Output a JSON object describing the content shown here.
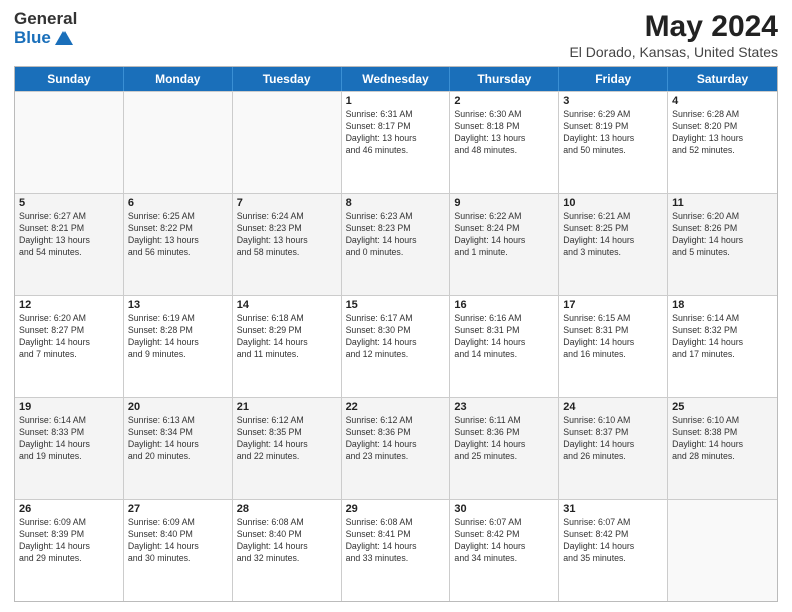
{
  "logo": {
    "general": "General",
    "blue": "Blue"
  },
  "header": {
    "month_year": "May 2024",
    "location": "El Dorado, Kansas, United States"
  },
  "days_of_week": [
    "Sunday",
    "Monday",
    "Tuesday",
    "Wednesday",
    "Thursday",
    "Friday",
    "Saturday"
  ],
  "rows": [
    {
      "alt": false,
      "cells": [
        {
          "day": "",
          "info": ""
        },
        {
          "day": "",
          "info": ""
        },
        {
          "day": "",
          "info": ""
        },
        {
          "day": "1",
          "info": "Sunrise: 6:31 AM\nSunset: 8:17 PM\nDaylight: 13 hours\nand 46 minutes."
        },
        {
          "day": "2",
          "info": "Sunrise: 6:30 AM\nSunset: 8:18 PM\nDaylight: 13 hours\nand 48 minutes."
        },
        {
          "day": "3",
          "info": "Sunrise: 6:29 AM\nSunset: 8:19 PM\nDaylight: 13 hours\nand 50 minutes."
        },
        {
          "day": "4",
          "info": "Sunrise: 6:28 AM\nSunset: 8:20 PM\nDaylight: 13 hours\nand 52 minutes."
        }
      ]
    },
    {
      "alt": true,
      "cells": [
        {
          "day": "5",
          "info": "Sunrise: 6:27 AM\nSunset: 8:21 PM\nDaylight: 13 hours\nand 54 minutes."
        },
        {
          "day": "6",
          "info": "Sunrise: 6:25 AM\nSunset: 8:22 PM\nDaylight: 13 hours\nand 56 minutes."
        },
        {
          "day": "7",
          "info": "Sunrise: 6:24 AM\nSunset: 8:23 PM\nDaylight: 13 hours\nand 58 minutes."
        },
        {
          "day": "8",
          "info": "Sunrise: 6:23 AM\nSunset: 8:23 PM\nDaylight: 14 hours\nand 0 minutes."
        },
        {
          "day": "9",
          "info": "Sunrise: 6:22 AM\nSunset: 8:24 PM\nDaylight: 14 hours\nand 1 minute."
        },
        {
          "day": "10",
          "info": "Sunrise: 6:21 AM\nSunset: 8:25 PM\nDaylight: 14 hours\nand 3 minutes."
        },
        {
          "day": "11",
          "info": "Sunrise: 6:20 AM\nSunset: 8:26 PM\nDaylight: 14 hours\nand 5 minutes."
        }
      ]
    },
    {
      "alt": false,
      "cells": [
        {
          "day": "12",
          "info": "Sunrise: 6:20 AM\nSunset: 8:27 PM\nDaylight: 14 hours\nand 7 minutes."
        },
        {
          "day": "13",
          "info": "Sunrise: 6:19 AM\nSunset: 8:28 PM\nDaylight: 14 hours\nand 9 minutes."
        },
        {
          "day": "14",
          "info": "Sunrise: 6:18 AM\nSunset: 8:29 PM\nDaylight: 14 hours\nand 11 minutes."
        },
        {
          "day": "15",
          "info": "Sunrise: 6:17 AM\nSunset: 8:30 PM\nDaylight: 14 hours\nand 12 minutes."
        },
        {
          "day": "16",
          "info": "Sunrise: 6:16 AM\nSunset: 8:31 PM\nDaylight: 14 hours\nand 14 minutes."
        },
        {
          "day": "17",
          "info": "Sunrise: 6:15 AM\nSunset: 8:31 PM\nDaylight: 14 hours\nand 16 minutes."
        },
        {
          "day": "18",
          "info": "Sunrise: 6:14 AM\nSunset: 8:32 PM\nDaylight: 14 hours\nand 17 minutes."
        }
      ]
    },
    {
      "alt": true,
      "cells": [
        {
          "day": "19",
          "info": "Sunrise: 6:14 AM\nSunset: 8:33 PM\nDaylight: 14 hours\nand 19 minutes."
        },
        {
          "day": "20",
          "info": "Sunrise: 6:13 AM\nSunset: 8:34 PM\nDaylight: 14 hours\nand 20 minutes."
        },
        {
          "day": "21",
          "info": "Sunrise: 6:12 AM\nSunset: 8:35 PM\nDaylight: 14 hours\nand 22 minutes."
        },
        {
          "day": "22",
          "info": "Sunrise: 6:12 AM\nSunset: 8:36 PM\nDaylight: 14 hours\nand 23 minutes."
        },
        {
          "day": "23",
          "info": "Sunrise: 6:11 AM\nSunset: 8:36 PM\nDaylight: 14 hours\nand 25 minutes."
        },
        {
          "day": "24",
          "info": "Sunrise: 6:10 AM\nSunset: 8:37 PM\nDaylight: 14 hours\nand 26 minutes."
        },
        {
          "day": "25",
          "info": "Sunrise: 6:10 AM\nSunset: 8:38 PM\nDaylight: 14 hours\nand 28 minutes."
        }
      ]
    },
    {
      "alt": false,
      "cells": [
        {
          "day": "26",
          "info": "Sunrise: 6:09 AM\nSunset: 8:39 PM\nDaylight: 14 hours\nand 29 minutes."
        },
        {
          "day": "27",
          "info": "Sunrise: 6:09 AM\nSunset: 8:40 PM\nDaylight: 14 hours\nand 30 minutes."
        },
        {
          "day": "28",
          "info": "Sunrise: 6:08 AM\nSunset: 8:40 PM\nDaylight: 14 hours\nand 32 minutes."
        },
        {
          "day": "29",
          "info": "Sunrise: 6:08 AM\nSunset: 8:41 PM\nDaylight: 14 hours\nand 33 minutes."
        },
        {
          "day": "30",
          "info": "Sunrise: 6:07 AM\nSunset: 8:42 PM\nDaylight: 14 hours\nand 34 minutes."
        },
        {
          "day": "31",
          "info": "Sunrise: 6:07 AM\nSunset: 8:42 PM\nDaylight: 14 hours\nand 35 minutes."
        },
        {
          "day": "",
          "info": ""
        }
      ]
    }
  ]
}
